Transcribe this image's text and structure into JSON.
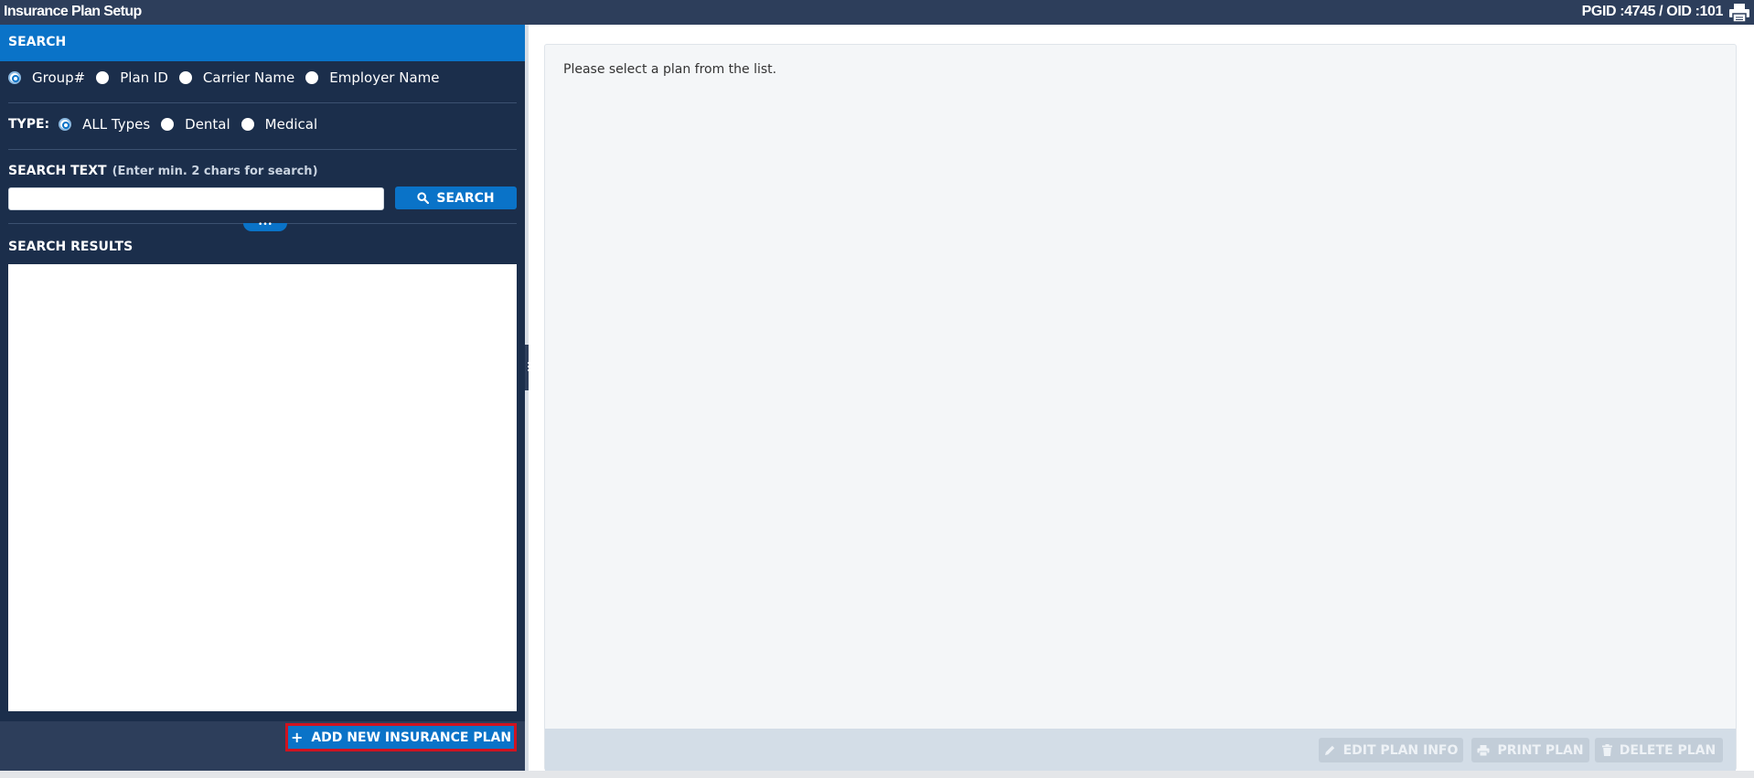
{
  "window": {
    "title": "Insurance Plan Setup",
    "ids": "PGID :4745  /  OID :101"
  },
  "search": {
    "header": "SEARCH",
    "by_options": [
      {
        "label": "Group#",
        "checked": true
      },
      {
        "label": "Plan ID",
        "checked": false
      },
      {
        "label": "Carrier Name",
        "checked": false
      },
      {
        "label": "Employer Name",
        "checked": false
      }
    ],
    "type_label": "TYPE:",
    "type_options": [
      {
        "label": "ALL Types",
        "checked": true
      },
      {
        "label": "Dental",
        "checked": false
      },
      {
        "label": "Medical",
        "checked": false
      }
    ],
    "text_label": "SEARCH TEXT",
    "text_hint": "(Enter min. 2 chars for search)",
    "input_value": "",
    "button_label": "SEARCH",
    "handle_glyph": "•••",
    "results_label": "SEARCH RESULTS",
    "add_button_label": "ADD NEW INSURANCE PLAN",
    "add_button_glyph": "+"
  },
  "detail": {
    "message": "Please select a plan from the list.",
    "actions": [
      {
        "label": "EDIT PLAN INFO",
        "icon": "pencil-icon",
        "enabled": false
      },
      {
        "label": "PRINT PLAN",
        "icon": "printer-icon",
        "enabled": false
      },
      {
        "label": "DELETE PLAN",
        "icon": "trash-icon",
        "enabled": false
      }
    ]
  },
  "colors": {
    "titlebar": "#2d3e5b",
    "panel": "#1b2e4b",
    "accent": "#0a73c8",
    "highlight_border": "#d0131f",
    "disabled_button": "#c2cdd8"
  }
}
